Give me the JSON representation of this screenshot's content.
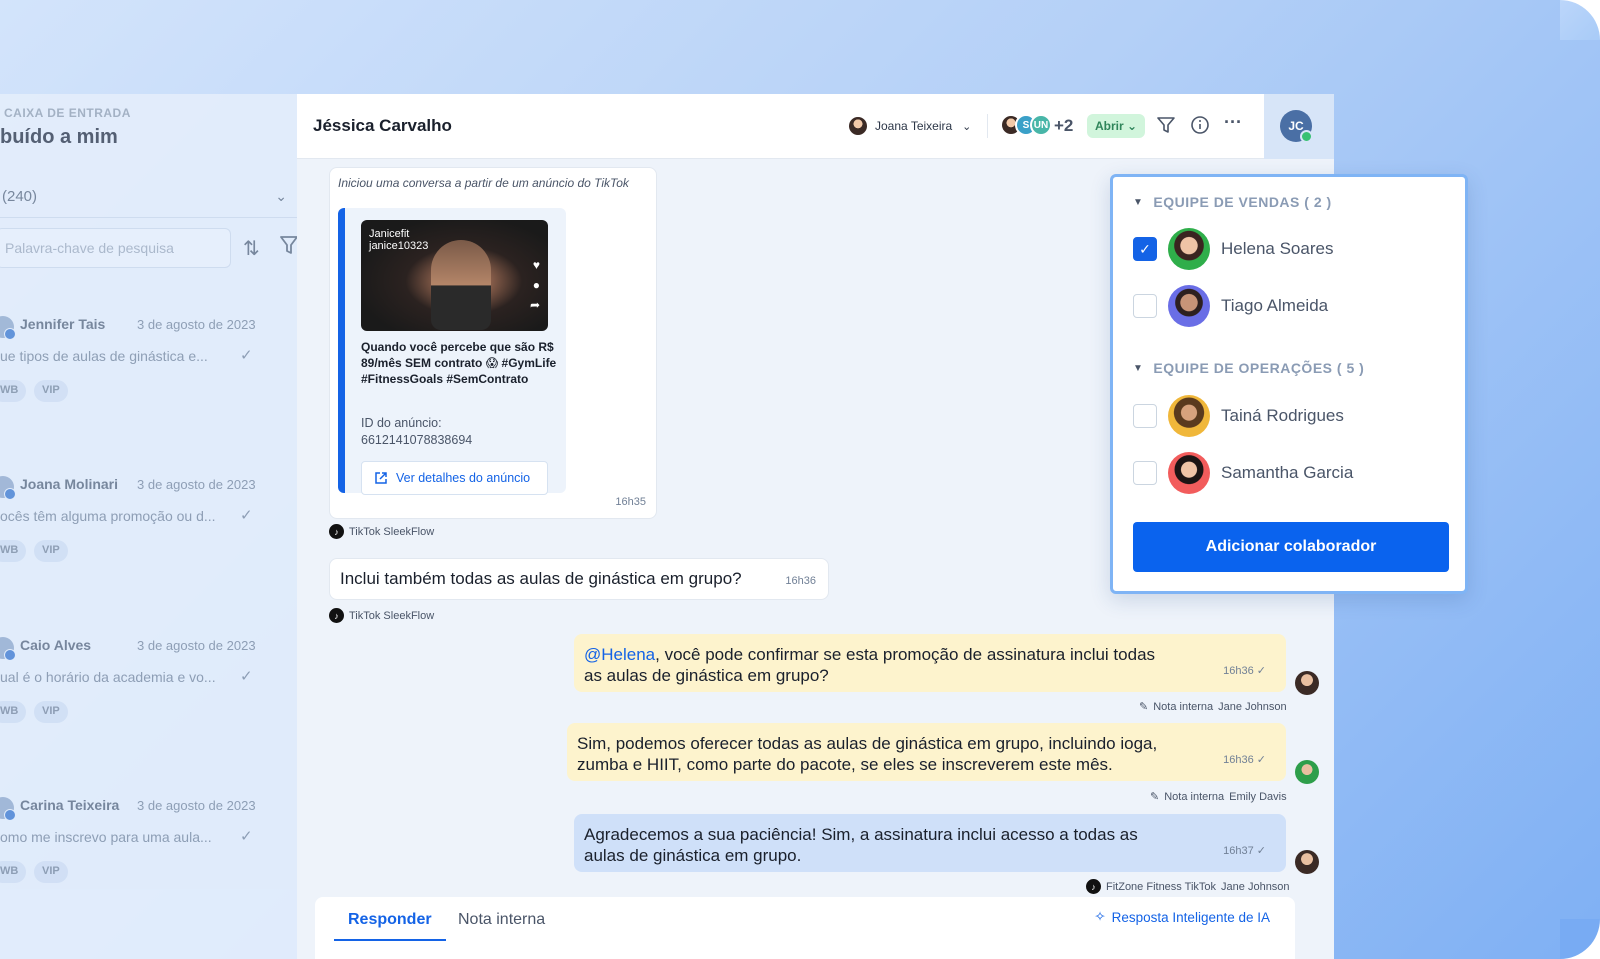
{
  "inbox": {
    "label": "CAIXA DE ENTRADA",
    "title": "buído a mim",
    "count": "(240)",
    "search_placeholder": "Palavra-chave de pesquisa",
    "conversations": [
      {
        "name": "Jennifer Tais",
        "date": "3 de agosto de 2023",
        "preview": "ue tipos de aulas de ginástica e...",
        "tags": [
          "WB",
          "VIP"
        ]
      },
      {
        "name": "Joana Molinari",
        "date": "3 de agosto de 2023",
        "preview": "ocês têm alguma promoção ou d...",
        "tags": [
          "WB",
          "VIP"
        ]
      },
      {
        "name": "Caio Alves",
        "date": "3 de agosto de 2023",
        "preview": "ual é o horário da academia e vo...",
        "tags": [
          "WB",
          "VIP"
        ]
      },
      {
        "name": "Carina Teixeira",
        "date": "3 de agosto de 2023",
        "preview": "omo me inscrevo para uma aula...",
        "tags": [
          "WB",
          "VIP"
        ]
      }
    ]
  },
  "header": {
    "title": "Jéssica Carvalho",
    "assignee": "Joana Teixeira",
    "collab_initials": [
      "S",
      "UN"
    ],
    "collab_more": "+2",
    "status": "Abrir",
    "me_initials": "JC"
  },
  "ad": {
    "intro": "Iniciou uma conversa a partir de um anúncio do TikTok",
    "account": "Janicefit",
    "handle": "janice10323",
    "text": "Quando você percebe que são R$ 89/mês SEM contrato 😱 #GymLife #FitnessGoals #SemContrato",
    "id_label": "ID do anúncio:",
    "id_value": "6612141078838694",
    "button": "Ver detalhes do anúncio",
    "time": "16h35"
  },
  "messages": {
    "source1": "TikTok SleekFlow",
    "incoming": "Inclui também todas as aulas de ginástica em grupo?",
    "incoming_time": "16h36",
    "source2": "TikTok SleekFlow",
    "note1_mention": "@Helena",
    "note1_text": ", você pode confirmar se esta promoção de assinatura inclui todas as aulas de ginástica em grupo?",
    "note1_time": "16h36 ✓",
    "note1_meta": "Nota interna",
    "note1_author": "Jane Johnson",
    "note2_text": "Sim, podemos oferecer todas as aulas de ginástica em grupo, incluindo ioga, zumba e HIIT, como parte do pacote, se eles se inscreverem este mês.",
    "note2_time": "16h36 ✓",
    "note2_meta": "Nota interna",
    "note2_author": "Emily Davis",
    "reply_text": "Agradecemos a sua paciência! Sim, a assinatura inclui acesso a todas as aulas de ginástica em grupo.",
    "reply_time": "16h37 ✓",
    "reply_channel": "FitZone Fitness TikTok",
    "reply_author": "Jane Johnson"
  },
  "composer": {
    "tab_reply": "Responder",
    "tab_note": "Nota interna",
    "ai": "Resposta Inteligente de IA"
  },
  "collab_popup": {
    "group1": "EQUIPE DE VENDAS ( 2 )",
    "group1_people": [
      {
        "name": "Helena Soares",
        "checked": true
      },
      {
        "name": "Tiago Almeida",
        "checked": false
      }
    ],
    "group2": "EQUIPE DE OPERAÇÕES ( 5 )",
    "group2_people": [
      {
        "name": "Tainá Rodrigues",
        "checked": false
      },
      {
        "name": "Samantha Garcia",
        "checked": false
      }
    ],
    "button": "Adicionar colaborador"
  }
}
